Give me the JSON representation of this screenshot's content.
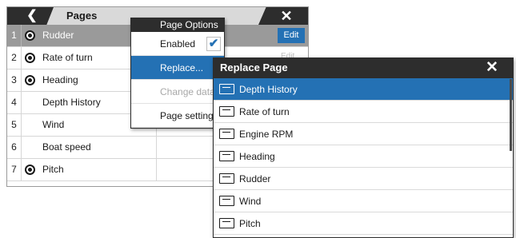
{
  "pages_panel": {
    "title": "Pages",
    "back_icon": "chevron-left-icon",
    "close_icon": "close-icon",
    "rows": [
      {
        "num": "1",
        "label": "Rudder",
        "has_icon": true,
        "selected": true
      },
      {
        "num": "2",
        "label": "Rate of turn",
        "has_icon": true,
        "selected": false
      },
      {
        "num": "3",
        "label": "Heading",
        "has_icon": true,
        "selected": false
      },
      {
        "num": "4",
        "label": "Depth History",
        "has_icon": false,
        "selected": false
      },
      {
        "num": "5",
        "label": "Wind",
        "has_icon": false,
        "selected": false
      },
      {
        "num": "6",
        "label": "Boat speed",
        "has_icon": false,
        "selected": false
      },
      {
        "num": "7",
        "label": "Pitch",
        "has_icon": true,
        "selected": false
      }
    ],
    "edit_label": "Edit",
    "edit_ghost_label": "Edit"
  },
  "page_options": {
    "title": "Page Options",
    "items": [
      {
        "label": "Enabled",
        "checked": true
      },
      {
        "label": "Replace...",
        "active": true
      },
      {
        "label": "Change data",
        "disabled": true
      },
      {
        "label": "Page settings"
      }
    ]
  },
  "replace_page": {
    "title": "Replace Page",
    "close_icon": "close-icon",
    "items": [
      {
        "label": "Depth History",
        "icon": "depth-history-icon",
        "selected": true
      },
      {
        "label": "Rate of turn",
        "icon": "rate-of-turn-icon"
      },
      {
        "label": "Engine RPM",
        "icon": "engine-rpm-icon"
      },
      {
        "label": "Heading",
        "icon": "heading-icon"
      },
      {
        "label": "Rudder",
        "icon": "rudder-icon"
      },
      {
        "label": "Wind",
        "icon": "wind-icon"
      },
      {
        "label": "Pitch",
        "icon": "pitch-icon"
      }
    ]
  },
  "colors": {
    "accent": "#2471b4",
    "header_dark": "#2d2d2d",
    "selected_gray": "#9a9a9a"
  }
}
